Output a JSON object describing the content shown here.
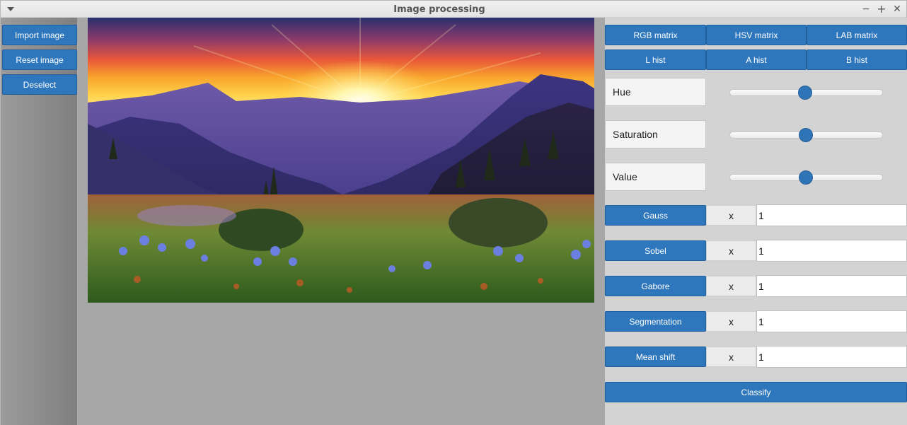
{
  "window": {
    "title": "Image processing"
  },
  "titlebar_icons": {
    "menu": "chevron-down-icon",
    "minimize": "minimize-icon",
    "maximize": "plus-icon",
    "close": "close-icon"
  },
  "left": {
    "buttons": [
      "Import image",
      "Reset image",
      "Deselect"
    ]
  },
  "image": {
    "subject": "mountain sunset landscape"
  },
  "right": {
    "matrix_buttons": [
      "RGB matrix",
      "HSV matrix",
      "LAB matrix"
    ],
    "hist_buttons": [
      "L hist",
      "A hist",
      "B hist"
    ],
    "sliders": [
      {
        "label": "Hue",
        "value": 0.5
      },
      {
        "label": "Saturation",
        "value": 0.5
      },
      {
        "label": "Value",
        "value": 0.5
      }
    ],
    "filters": [
      {
        "label": "Gauss",
        "x": "x",
        "value": "1"
      },
      {
        "label": "Sobel",
        "x": "x",
        "value": "1"
      },
      {
        "label": "Gabore",
        "x": "x",
        "value": "1"
      },
      {
        "label": "Segmentation",
        "x": "x",
        "value": "1"
      },
      {
        "label": "Mean shift",
        "x": "x",
        "value": "1"
      }
    ],
    "classify": "Classify"
  },
  "colors": {
    "accent": "#2f77bd",
    "panel": "#d3d3d3",
    "canvas": "#a7a7a7"
  }
}
